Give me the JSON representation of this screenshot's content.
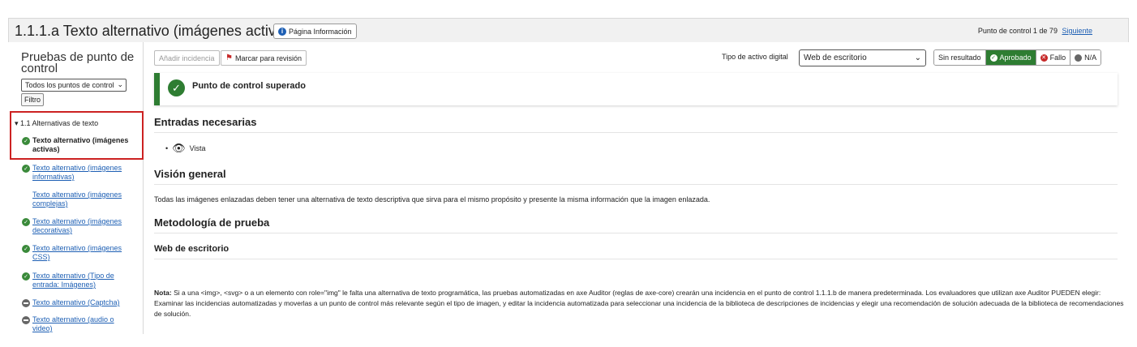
{
  "header": {
    "title": "1.1.1.a Texto alternativo (imágenes activas)",
    "info_button": "Página Información",
    "counter": "Punto de control 1 de 79",
    "next_link": "Siguiente"
  },
  "sidebar": {
    "title": "Pruebas de punto de control",
    "filter_select": "Todos los puntos de control",
    "filter_button": "Filtro",
    "group": "▾ 1.1 Alternativas de texto",
    "items": [
      {
        "label": "Texto alternativo (imágenes activas)",
        "status": "passed",
        "current": true
      },
      {
        "label": "Texto alternativo (imágenes informativas)",
        "status": "passed"
      },
      {
        "label": "Texto alternativo (imágenes complejas)",
        "status": "none"
      },
      {
        "label": "Texto alternativo (imágenes decorativas)",
        "status": "passed"
      },
      {
        "label": "Texto alternativo (imágenes CSS)",
        "status": "passed"
      },
      {
        "label": "Texto alternativo (Tipo de entrada: Imágenes)",
        "status": "passed"
      },
      {
        "label": "Texto alternativo (Captcha)",
        "status": "na"
      },
      {
        "label": "Texto alternativo (audio o video)",
        "status": "na"
      }
    ]
  },
  "toolbar": {
    "add_issue": "Añadir incidencia",
    "mark_review": "Marcar para revisión",
    "asset_type_label": "Tipo de activo digital",
    "asset_type_value": "Web de escritorio",
    "results": {
      "none": "Sin resultado",
      "pass": "Aprobado",
      "fail": "Fallo",
      "na": "N/A"
    }
  },
  "banner": {
    "text": "Punto de control superado"
  },
  "sections": {
    "required_inputs": "Entradas necesarias",
    "required_item": "Vista",
    "overview": "Visión general",
    "overview_text": "Todas las imágenes enlazadas deben tener una alternativa de texto descriptiva que sirva para el mismo propósito y presente la misma información que la imagen enlazada.",
    "methodology": "Metodología de prueba",
    "methodology_sub": "Web de escritorio",
    "note_label": "Nota:",
    "note_text": "Si a una <img>, <svg> o a un elemento con role=\"img\" le falta una alternativa de texto programática, las pruebas automatizadas en axe Auditor (reglas de axe-core) crearán una incidencia en el punto de control 1.1.1.b de manera predeterminada. Los evaluadores que utilizan axe Auditor PUEDEN elegir: Examinar las incidencias automatizadas y moverlas a un punto de control más relevante según el tipo de imagen, y editar la incidencia automatizada para seleccionar una incidencia de la biblioteca de descripciones de incidencias y elegir una recomendación de solución adecuada de la biblioteca de recomendaciones de solución."
  },
  "colors": {
    "pass": "#2e7d32",
    "fail": "#c62828",
    "link": "#1d5fb4",
    "highlight": "#cc2222"
  }
}
